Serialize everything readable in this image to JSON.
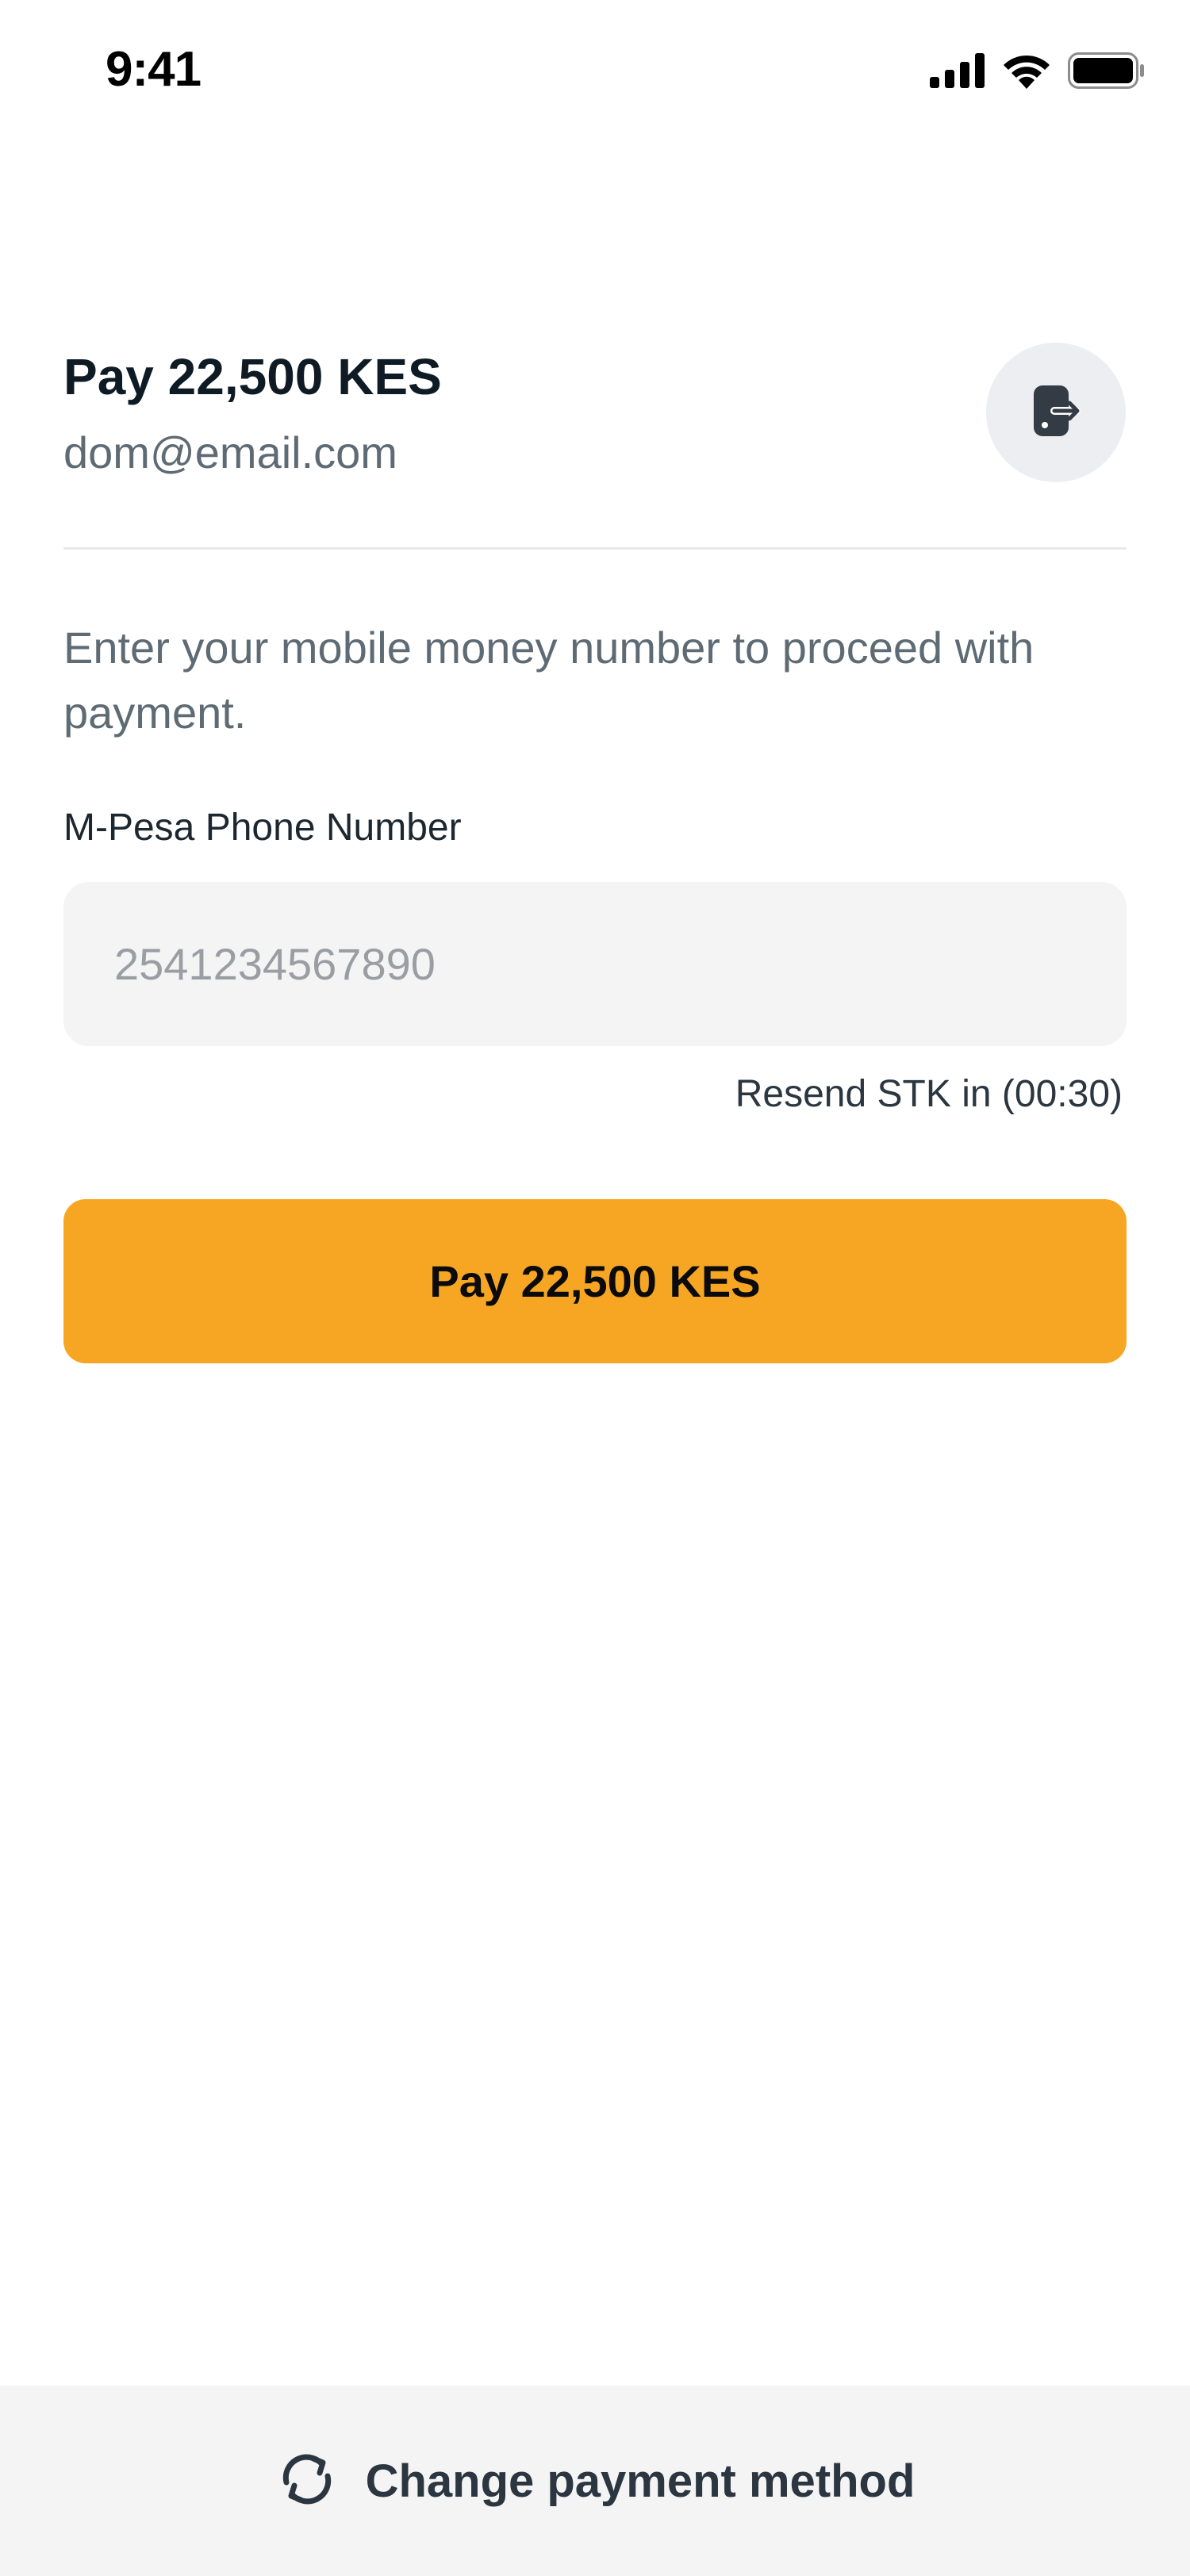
{
  "status_bar": {
    "time": "9:41",
    "icons": [
      "cellular-signal-icon",
      "wifi-icon",
      "battery-icon"
    ]
  },
  "header": {
    "title": "Pay 22,500 KES",
    "email": "dom@email.com",
    "logout_icon": "logout-icon"
  },
  "form": {
    "instructions": "Enter your mobile money number to proceed with payment.",
    "phone_label": "M-Pesa Phone Number",
    "phone_placeholder": "2541234567890",
    "phone_value": "",
    "resend_text": "Resend STK in (00:30)",
    "pay_button_label": "Pay 22,500 KES"
  },
  "footer": {
    "change_method_label": "Change payment method",
    "change_method_icon": "refresh-icon"
  },
  "colors": {
    "accent": "#f6a623",
    "text_primary": "#0f1b24",
    "text_secondary": "#5f6b74",
    "input_bg": "#f4f4f5",
    "footer_bg": "#f4f4f5",
    "icon_button_bg": "#eceef1"
  }
}
